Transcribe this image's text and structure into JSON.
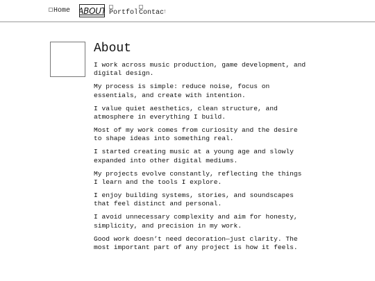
{
  "nav": {
    "home": "Home",
    "about": "ABOUT",
    "portfolio": "Portfolio",
    "contact": "Contact"
  },
  "page": {
    "title": "About",
    "paragraphs": [
      "I work across music production, game development, and digital design.",
      "My process is simple: reduce noise, focus on essentials, and create with intention.",
      "I value quiet aesthetics, clean structure, and atmosphere in everything I build.",
      "Most of my work comes from curiosity and the desire to shape ideas into something real.",
      "I started creating music at a young age and slowly expanded into other digital mediums.",
      "My projects evolve constantly, reflecting the things I learn and the tools I explore.",
      "I enjoy building systems, stories, and soundscapes that feel distinct and personal.",
      "I avoid unnecessary complexity and aim for honesty, simplicity, and precision in my work.",
      "Good work doesn’t need decoration—just clarity. The most important part of any project is how it feels."
    ]
  }
}
